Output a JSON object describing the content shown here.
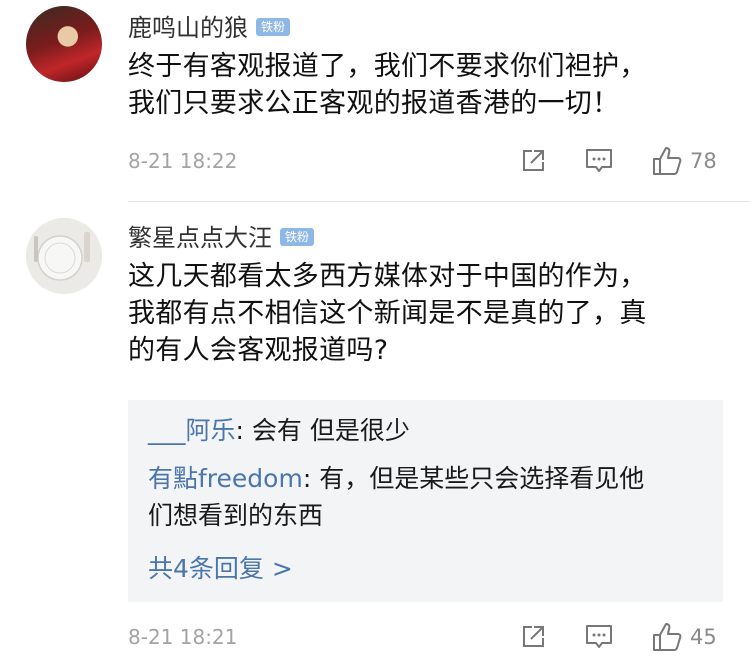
{
  "comments": [
    {
      "username": "鹿鸣山的狼",
      "badge": "铁粉",
      "text": "终于有客观报道了，我们不要求你们袒护，\n我们只要求公正客观的报道香港的一切！",
      "time": "8-21 18:22",
      "likes": "78"
    },
    {
      "username": "繁星点点大汪",
      "badge": "铁粉",
      "text": "这几天都看太多西方媒体对于中国的作为，\n我都有点不相信这个新闻是不是真的了，真\n的有人会客观报道吗?",
      "time": "8-21 18:21",
      "likes": "45",
      "replies": [
        {
          "user": "___阿乐",
          "text": "会有  但是很少"
        },
        {
          "user": "有點freedom",
          "text": "有，但是某些只会选择看见他",
          "text2": "们想看到的东西"
        }
      ],
      "more": "共4条回复 >"
    }
  ],
  "icons": {
    "share": "share-icon",
    "comment": "comment-icon",
    "like": "thumbs-up-icon"
  },
  "colors": {
    "badge": "#8fb7e6",
    "reply_user": "#4a76ad",
    "time": "#a3a3a3"
  }
}
